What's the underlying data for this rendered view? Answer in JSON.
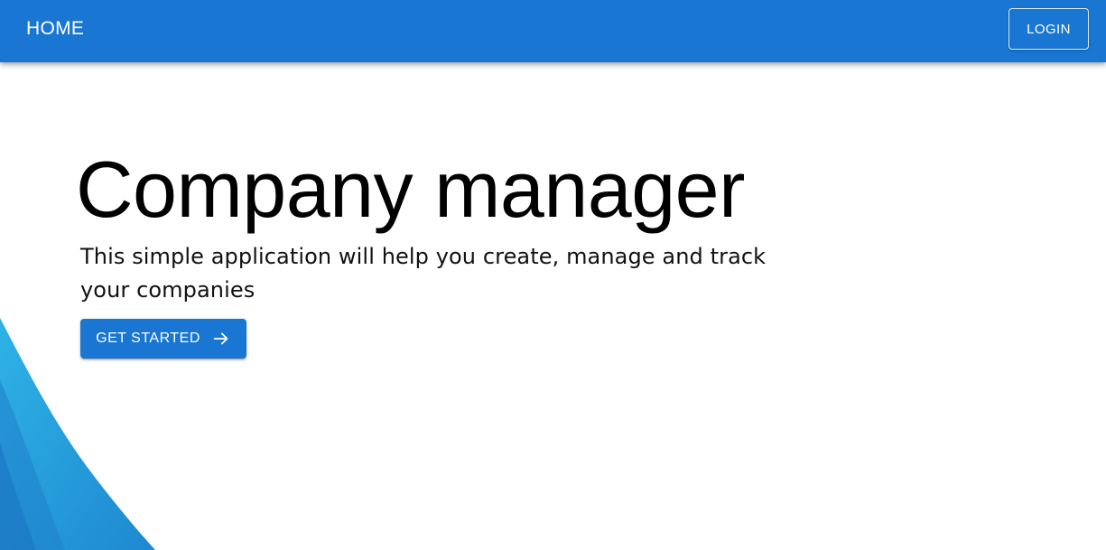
{
  "header": {
    "home_label": "HOME",
    "login_label": "LOGIN"
  },
  "hero": {
    "title": "Company manager",
    "subtitle": "This simple application will help you create, manage and track your companies",
    "cta_label": "GET STARTED",
    "cta_icon": "arrow-right-icon"
  },
  "colors": {
    "primary": "#1976d2",
    "wave_light": "#29a9e0",
    "wave_dark": "#1f82cf",
    "background": "#ffffff"
  }
}
